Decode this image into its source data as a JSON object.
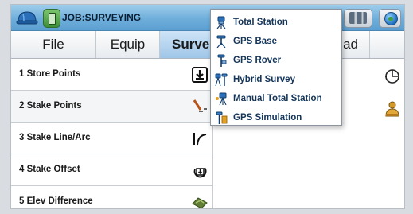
{
  "titlebar": {
    "job_title": "JOB:SURVEYING",
    "helmet_icon": "hard-hat-icon",
    "job_icon": "job-file-icon",
    "status_icons": [
      "satellite-signal-icon",
      "globe-icon"
    ]
  },
  "tabs": [
    {
      "label": "File"
    },
    {
      "label": "Equip"
    },
    {
      "label": "Surve"
    },
    {
      "label": "ad"
    }
  ],
  "survey_list": [
    {
      "label": "1 Store Points",
      "icon": "store-point-icon"
    },
    {
      "label": "2 Stake Points",
      "icon": "stake-point-icon"
    },
    {
      "label": "3 Stake Line/Arc",
      "icon": "line-arc-icon"
    },
    {
      "label": "4 Stake Offset",
      "icon": "stake-offset-icon"
    },
    {
      "label": "5 Elev Difference",
      "icon": "elevation-difference-icon"
    }
  ],
  "right_icons": [
    "target-icon",
    "surveyor-icon"
  ],
  "survey_menu": {
    "items": [
      {
        "label": "Total Station",
        "icon": "total-station-icon"
      },
      {
        "label": "GPS Base",
        "icon": "gps-base-icon"
      },
      {
        "label": "GPS Rover",
        "icon": "gps-rover-icon"
      },
      {
        "label": "Hybrid Survey",
        "icon": "hybrid-survey-icon"
      },
      {
        "label": "Manual Total Station",
        "icon": "manual-total-station-icon"
      },
      {
        "label": "GPS Simulation",
        "icon": "gps-simulation-icon"
      }
    ]
  },
  "colors": {
    "titlebar": "#6eaedb",
    "active_tab": "#9fc6e8",
    "menu_text": "#14355a"
  }
}
